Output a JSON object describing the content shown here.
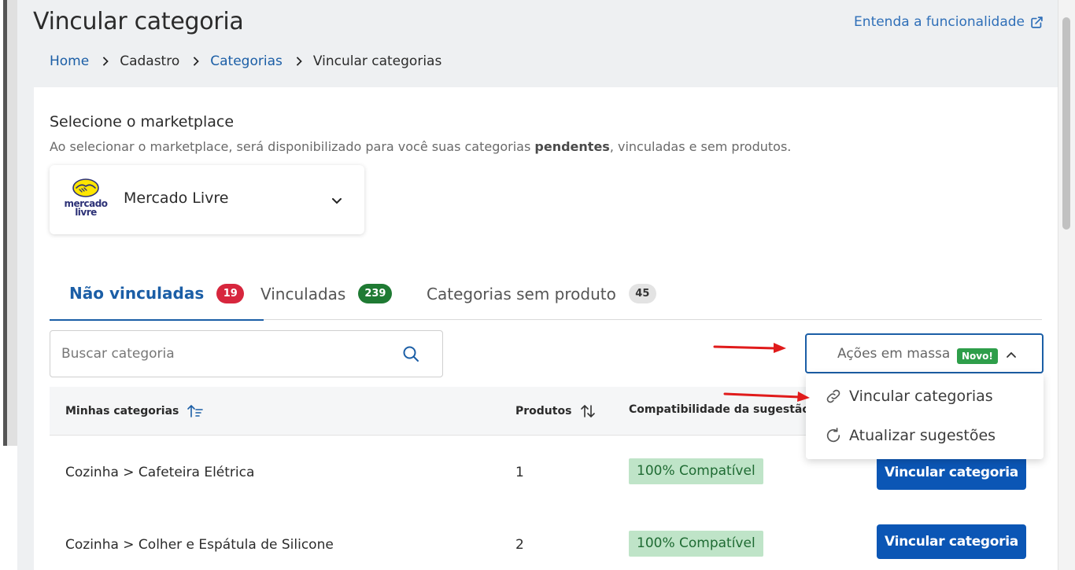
{
  "header": {
    "title": "Vincular categoria",
    "help_link": "Entenda a funcionalidade"
  },
  "breadcrumb": {
    "home": "Home",
    "cadastro": "Cadastro",
    "categorias": "Categorias",
    "current": "Vincular categorias"
  },
  "marketplace": {
    "title": "Selecione o marketplace",
    "subtitle_before": "Ao selecionar o marketplace, será disponibilizado para você suas categorias ",
    "subtitle_bold": "pendentes",
    "subtitle_after": ", vinculadas e sem produtos.",
    "logo_line1": "mercado",
    "logo_line2": "livre",
    "selected": "Mercado Livre"
  },
  "tabs": [
    {
      "label": "Não vinculadas",
      "count": "19"
    },
    {
      "label": "Vinculadas",
      "count": "239"
    },
    {
      "label": "Categorias sem produto",
      "count": "45"
    }
  ],
  "search": {
    "placeholder": "Buscar categoria"
  },
  "mass_actions": {
    "label": "Ações em massa",
    "badge": "Novo!",
    "items": [
      {
        "label": "Vincular categorias",
        "icon": "link-icon"
      },
      {
        "label": "Atualizar sugestões",
        "icon": "refresh-icon"
      }
    ]
  },
  "table": {
    "columns": {
      "category": "Minhas categorias",
      "products": "Produtos",
      "compatibility": "Compatibilidade da sugestão"
    },
    "rows": [
      {
        "category": "Cozinha > Cafeteira Elétrica",
        "products": "1",
        "compatibility": "100% Compatível",
        "action": "Vincular categoria"
      },
      {
        "category": "Cozinha > Colher e Espátula de Silicone",
        "products": "2",
        "compatibility": "100% Compatível",
        "action": "Vincular categoria"
      }
    ]
  },
  "colors": {
    "primary": "#1b5ea6",
    "button": "#0b56b5",
    "badge_red": "#d7263d",
    "badge_green": "#1f7a33",
    "compat_bg": "#bfe4c8",
    "annotation_arrow": "#e01b1b"
  }
}
